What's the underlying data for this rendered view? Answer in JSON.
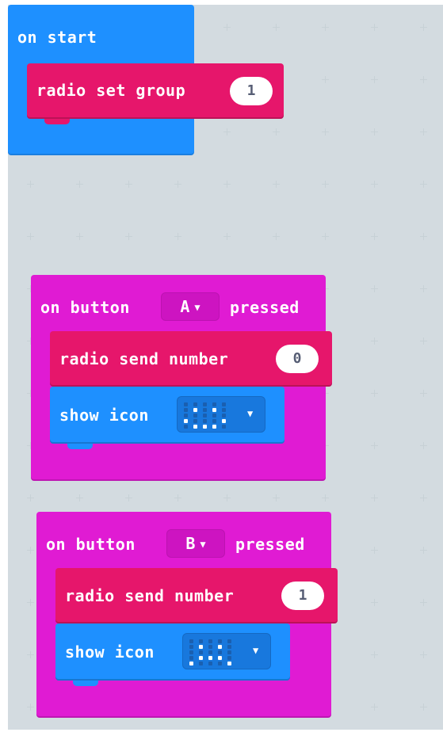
{
  "colors": {
    "workspace_bg": "#edf2f3",
    "basic_blue": "#1e90ff",
    "input_magenta": "#e01bd3",
    "radio_pink": "#e6166b",
    "led_on": "#ffffff",
    "led_off": "#1a5fb0"
  },
  "on_start": {
    "label": "on start",
    "radio_set_group": {
      "label": "radio set group",
      "value": "1"
    }
  },
  "button_a_event": {
    "prefix": "on button",
    "button": "A",
    "suffix": "pressed",
    "send": {
      "label": "radio send number",
      "value": "0"
    },
    "show_icon": {
      "label": "show icon",
      "icon_name": "happy-face-icon",
      "pattern": [
        [
          0,
          0,
          0,
          0,
          0
        ],
        [
          0,
          1,
          0,
          1,
          0
        ],
        [
          0,
          0,
          0,
          0,
          0
        ],
        [
          1,
          0,
          0,
          0,
          1
        ],
        [
          0,
          1,
          1,
          1,
          0
        ]
      ]
    }
  },
  "button_b_event": {
    "prefix": "on button",
    "button": "B",
    "suffix": "pressed",
    "send": {
      "label": "radio send number",
      "value": "1"
    },
    "show_icon": {
      "label": "show icon",
      "icon_name": "sad-face-icon",
      "pattern": [
        [
          0,
          0,
          0,
          0,
          0
        ],
        [
          0,
          1,
          0,
          1,
          0
        ],
        [
          0,
          0,
          0,
          0,
          0
        ],
        [
          0,
          1,
          1,
          1,
          0
        ],
        [
          1,
          0,
          0,
          0,
          1
        ]
      ]
    }
  }
}
